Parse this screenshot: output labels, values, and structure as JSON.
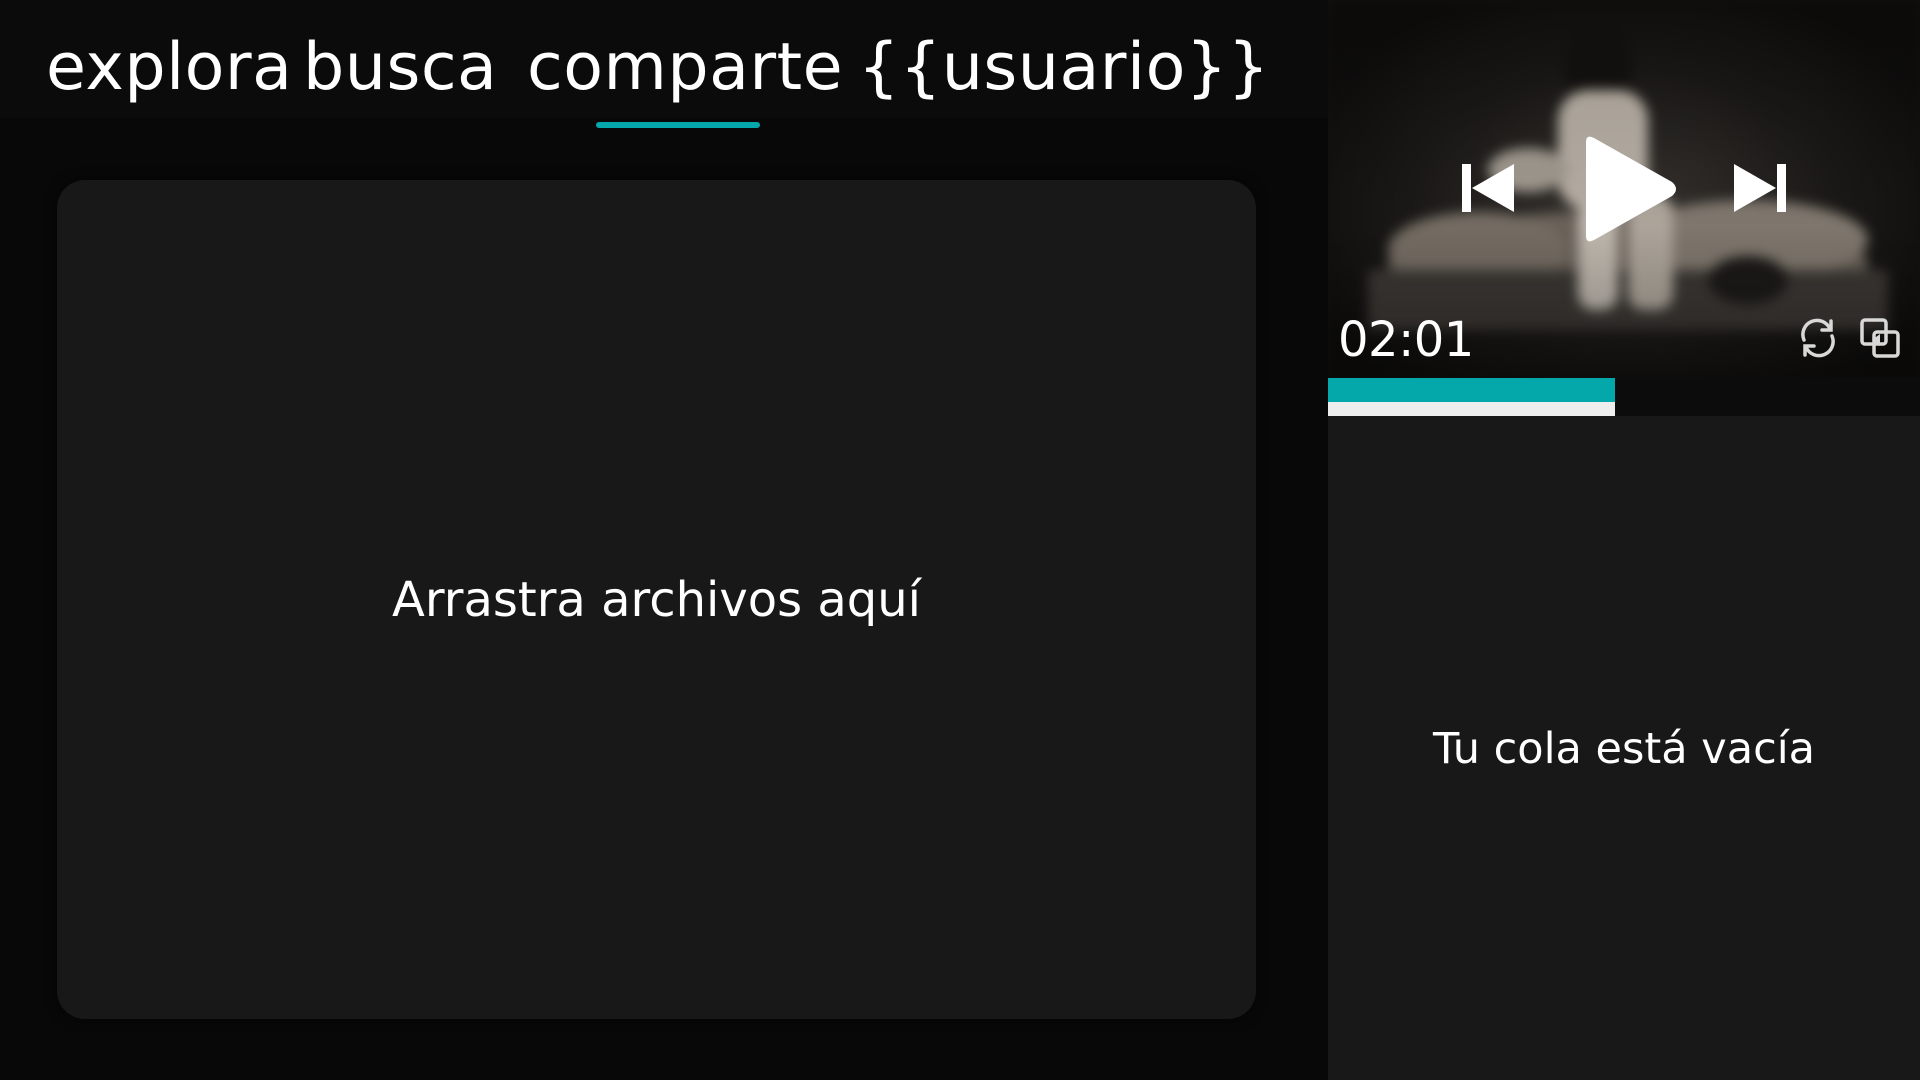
{
  "colors": {
    "accent": "#05a8aa",
    "background": "#080808",
    "panel": "#181818",
    "text": "#ffffff"
  },
  "nav": {
    "tabs": [
      {
        "label": "explora",
        "active": false
      },
      {
        "label": "busca",
        "active": false
      },
      {
        "label": "comparte",
        "active": true
      },
      {
        "label": "{{usuario}}",
        "active": false
      }
    ]
  },
  "dropzone": {
    "text": "Arrastra archivos aquí"
  },
  "player": {
    "time": "02:01",
    "progress_fraction": 0.485,
    "buffer_fraction": 0.485,
    "icons": {
      "previous": "skip-previous-icon",
      "play": "play-icon",
      "next": "skip-next-icon",
      "repeat": "repeat-icon",
      "share": "share-icon"
    }
  },
  "queue": {
    "empty_text": "Tu cola está vacía"
  }
}
